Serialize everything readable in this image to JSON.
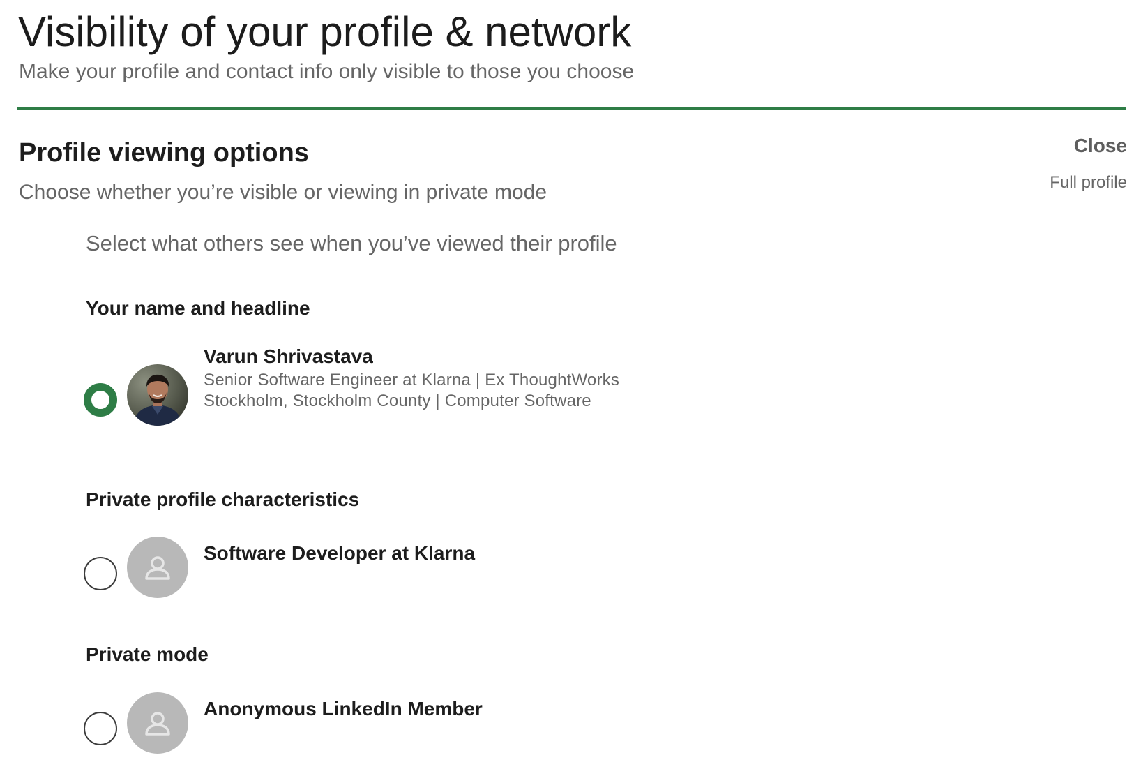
{
  "header": {
    "title": "Visibility of your profile & network",
    "subtitle": "Make your profile and contact info only visible to those you choose"
  },
  "section": {
    "title": "Profile viewing options",
    "description": "Choose whether you’re visible or viewing in private mode",
    "close_label": "Close",
    "current_value": "Full profile",
    "prompt": "Select what others see when you’ve viewed their profile"
  },
  "options": [
    {
      "heading": "Your name and headline",
      "name": "Varun Shrivastava",
      "headline": "Senior Software Engineer at Klarna | Ex ThoughtWorks",
      "location": "Stockholm, Stockholm County | Computer Software",
      "selected": true,
      "avatar": "user-photo"
    },
    {
      "heading": "Private profile characteristics",
      "name": "Software Developer at Klarna",
      "selected": false,
      "avatar": "person-placeholder-icon"
    },
    {
      "heading": "Private mode",
      "name": "Anonymous LinkedIn Member",
      "selected": false,
      "avatar": "person-placeholder-icon"
    }
  ],
  "colors": {
    "accent": "#2e7d46",
    "muted_text": "#666666",
    "placeholder_avatar": "#b8b8b8"
  }
}
